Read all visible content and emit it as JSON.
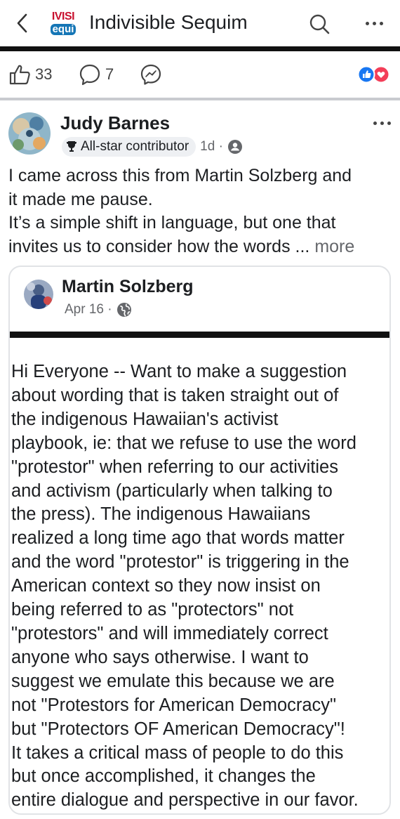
{
  "header": {
    "group_logo_text_top": "IVISI",
    "group_logo_text_bottom": "equi",
    "group_name": "Indivisible Sequim"
  },
  "engagement": {
    "likes": "33",
    "comments": "7"
  },
  "post": {
    "author": "Judy Barnes",
    "badge": "All-star contributor",
    "time": "1d ·",
    "text_lines": [
      "I came across this from Martin Solzberg and",
      "it made me pause.",
      "It’s a simple shift in language, but one that",
      "invites us to consider how the words ..."
    ],
    "see_more": "more"
  },
  "shared": {
    "author": "Martin Solzberg",
    "date": "Apr 16 ·",
    "body_lines": [
      "Hi Everyone -- Want to make a suggestion",
      "about wording that is taken straight out of",
      "the indigenous Hawaiian's activist",
      "playbook, ie: that we refuse to use the word",
      "\"protestor\" when referring to our activities",
      "and activism (particularly when talking to",
      "the press).  The indigenous Hawaiians",
      "realized a long time ago that words matter",
      "and the word \"protestor\" is triggering in the",
      "American context so they now insist on",
      "being referred to as \"protectors\" not",
      "\"protestors\" and will immediately correct",
      "anyone who says otherwise.  I want to",
      "suggest we emulate this because we are",
      "not \"Protestors for American Democracy\"",
      "but \"Protectors OF American Democracy\"!",
      "It takes a critical mass of people to do this",
      "but once accomplished, it changes the",
      "entire dialogue and perspective in our favor."
    ]
  },
  "colors": {
    "like_blue": "#1877f2",
    "love_red": "#f33e58",
    "meta_gray": "#65676b"
  }
}
